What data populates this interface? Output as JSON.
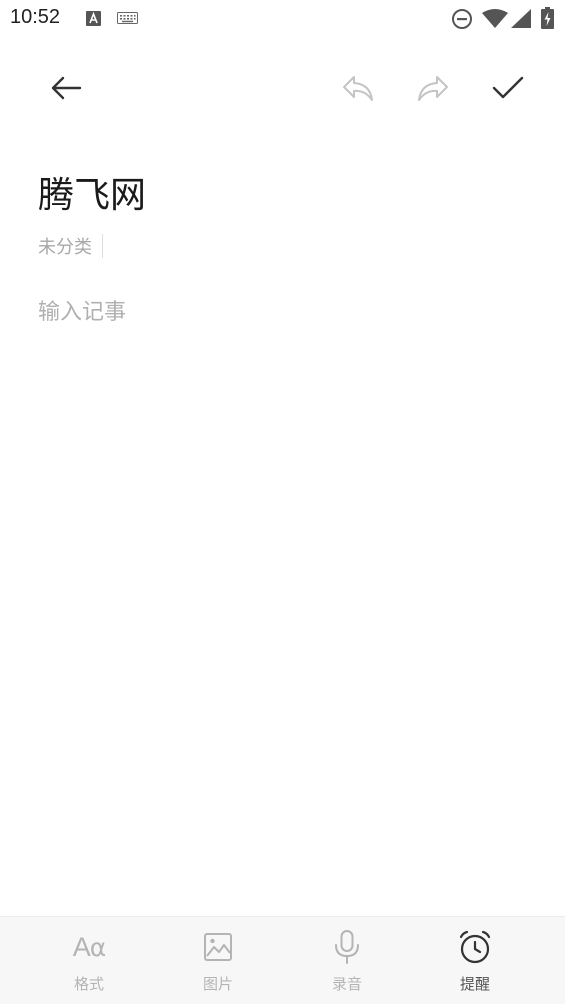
{
  "status_bar": {
    "time": "10:52"
  },
  "toolbar": {
    "back_icon": "arrow-left-icon",
    "undo_icon": "undo-icon",
    "redo_icon": "redo-icon",
    "confirm_icon": "check-icon"
  },
  "note": {
    "title": "腾飞网",
    "category": "未分类",
    "body_placeholder": "输入记事"
  },
  "bottom_tabs": [
    {
      "label": "格式",
      "icon": "text-format-icon",
      "active": false
    },
    {
      "label": "图片",
      "icon": "image-icon",
      "active": false
    },
    {
      "label": "录音",
      "icon": "microphone-icon",
      "active": false
    },
    {
      "label": "提醒",
      "icon": "alarm-clock-icon",
      "active": true
    }
  ],
  "colors": {
    "text_primary": "#1a1a1a",
    "text_muted": "#a8a8a8",
    "icon_disabled": "#c4c4c4",
    "icon_active": "#333333",
    "bottom_bar_bg": "#f7f7f7"
  }
}
